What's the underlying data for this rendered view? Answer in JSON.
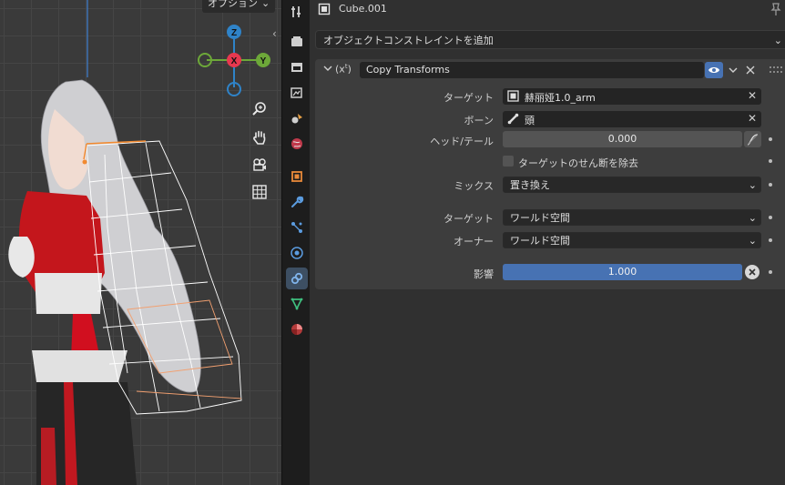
{
  "viewport": {
    "options_label": "オプション",
    "gizmo": {
      "z": "Z",
      "x": "X",
      "y": "Y"
    }
  },
  "header": {
    "object_name": "Cube.001"
  },
  "add_constraint_label": "オブジェクトコンストレイントを追加",
  "constraint": {
    "name": "Copy Transforms",
    "target_label": "ターゲット",
    "target_value": "赫丽娅1.0_arm",
    "bone_label": "ボーン",
    "bone_value": "頭",
    "head_tail_label": "ヘッド/テール",
    "head_tail_value": "0.000",
    "remove_shear_label": "ターゲットのせん断を除去",
    "mix_label": "ミックス",
    "mix_value": "置き換え",
    "target_space_label": "ターゲット",
    "target_space_value": "ワールド空間",
    "owner_space_label": "オーナー",
    "owner_space_value": "ワールド空間",
    "influence_label": "影響",
    "influence_value": "1.000",
    "influence_fraction": 1.0
  },
  "colors": {
    "accent_blue": "#4772b3",
    "gizmo_x": "#e8384f",
    "gizmo_y": "#6da839",
    "gizmo_z": "#2f83c8",
    "selection_orange": "#f28a30"
  }
}
